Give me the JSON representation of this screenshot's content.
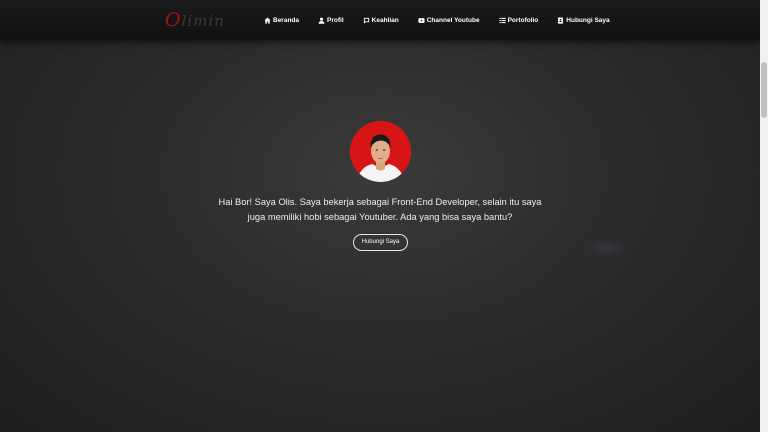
{
  "navbar": {
    "logo_initial": "O",
    "logo_rest": "limin",
    "items": [
      {
        "label": "Beranda",
        "icon": "home-icon"
      },
      {
        "label": "Profil",
        "icon": "user-icon"
      },
      {
        "label": "Keahlian",
        "icon": "tools-icon"
      },
      {
        "label": "Channel Youtube",
        "icon": "youtube-icon"
      },
      {
        "label": "Portofolio",
        "icon": "list-icon"
      },
      {
        "label": "Hubungi Saya",
        "icon": "address-book-icon"
      }
    ]
  },
  "hero": {
    "intro_line1": "Hai Bor! Saya Olis. Saya bekerja sebagai Front-End Developer, selain itu saya",
    "intro_line2": "juga memiliki hobi sebagai Youtuber. Ada yang bisa saya bantu?",
    "cta_label": "Hubungi Saya"
  },
  "colors": {
    "accent": "#d51516",
    "background": "#2b2b2b",
    "navbar": "#151515"
  }
}
